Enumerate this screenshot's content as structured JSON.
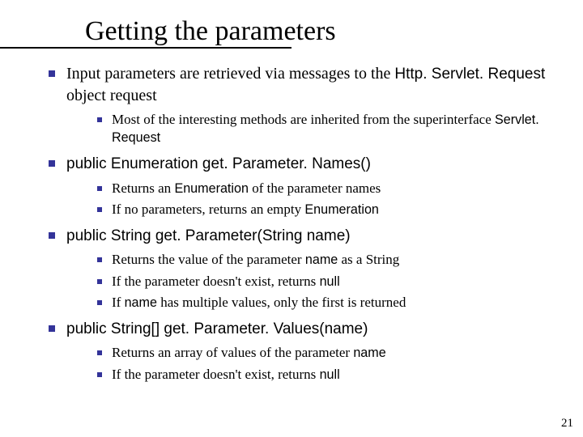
{
  "title": "Getting the parameters",
  "b1": {
    "part1": "Input parameters are retrieved via messages to the ",
    "code1": "Http. Servlet. Request",
    "part2": " object request",
    "sub1": {
      "part1": "Most of the interesting methods are inherited from the superinterface ",
      "code1": "Servlet. Request"
    }
  },
  "b2": {
    "code1": "public Enumeration get. Parameter. Names()",
    "sub1": {
      "part1": "Returns an ",
      "code1": "Enumeration",
      "part2": " of the parameter names"
    },
    "sub2": {
      "part1": "If no parameters, returns an empty ",
      "code1": "Enumeration"
    }
  },
  "b3": {
    "code1": "public String get. Parameter(String name)",
    "sub1": {
      "part1": "Returns the value of the parameter ",
      "code1": "name",
      "part2": " as a String"
    },
    "sub2": {
      "part1": "If the parameter doesn't exist, returns ",
      "code1": "null"
    },
    "sub3": {
      "part1": "If ",
      "code1": "name",
      "part2": " has multiple values, only the first is returned"
    }
  },
  "b4": {
    "code1": "public String[] get. Parameter. Values(name)",
    "sub1": {
      "part1": "Returns an array of values of the parameter ",
      "code1": "name"
    },
    "sub2": {
      "part1": "If the parameter doesn't exist, returns ",
      "code1": "null"
    }
  },
  "page_number": "21"
}
